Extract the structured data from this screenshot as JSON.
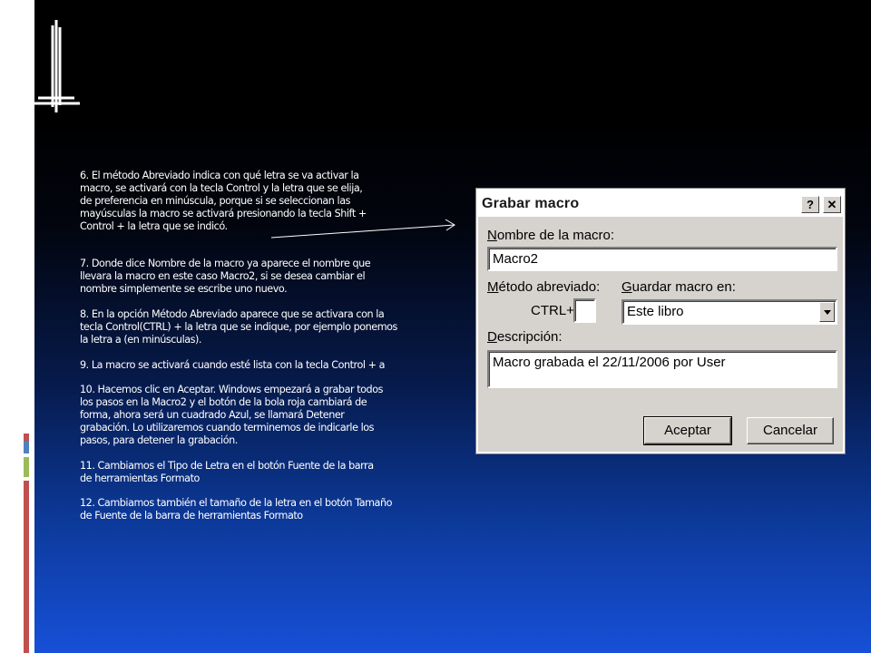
{
  "body": {
    "p6": [
      "6. El método Abreviado indica con qué letra se va activar la",
      "macro,  se activará con la tecla Control y la letra que se elija,",
      "de  preferencia en minúscula, porque si se seleccionan las",
      "mayúsculas  la macro se activará presionando la tecla Shift +",
      "Control + la letra que se indicó."
    ],
    "p7": [
      "7. Donde dice Nombre de la macro ya aparece el nombre que",
      "llevara  la macro en este caso Macro2, si se desea cambiar el",
      "nombre  simplemente se escribe uno nuevo."
    ],
    "p8": [
      "8. En la opción Método Abreviado aparece que se activara con la",
      "tecla Control(CTRL) + la letra que se indique, por ejemplo ponemos",
      "la letra a (en minúsculas)."
    ],
    "p9": [
      "9. La macro se activará cuando esté lista con la tecla Control + a"
    ],
    "p10": [
      "10. Hacemos clic en Aceptar. Windows empezará a grabar todos",
      "los  pasos en la Macro2 y el botón de la bola roja cambiará de",
      "forma,  ahora será un cuadrado Azul, se llamará Detener",
      "grabación. Lo  utilizaremos cuando terminemos de indicarle los",
      "pasos, para  detener la grabación."
    ],
    "p11": [
      "11. Cambiamos el Tipo de Letra en el botón Fuente de la barra",
      "de  herramientas Formato"
    ],
    "p12": [
      "12. Cambiamos también el tamaño de la letra en el botón Tamaño",
      "de  Fuente de la barra de herramientas Formato"
    ]
  },
  "dialog": {
    "title": "Grabar macro",
    "help_label": "?",
    "close_label": "✕",
    "macro_name_label_u": "N",
    "macro_name_label_rest": "ombre de la macro:",
    "macro_name_value": "Macro2",
    "shortcut_label_u": "M",
    "shortcut_label_rest": "étodo abreviado:",
    "ctrl_prefix": "CTRL+",
    "ctrl_key_value": "",
    "store_label_u": "G",
    "store_label_rest": "uardar macro en:",
    "store_value": "Este libro",
    "description_label_u": "D",
    "description_label_rest": "escripción:",
    "description_value": "Macro grabada el 22/11/2006 por User",
    "ok_label": "Aceptar",
    "cancel_label": "Cancelar"
  },
  "colors": {
    "accent_bars": [
      "#c0504d",
      "#4f81bd",
      "#9bbb59",
      "#c0504d"
    ]
  },
  "icons": {
    "help": "help-icon",
    "close": "close-icon",
    "dropdown": "chevron-down-icon",
    "arrow": "arrow-right-icon"
  }
}
